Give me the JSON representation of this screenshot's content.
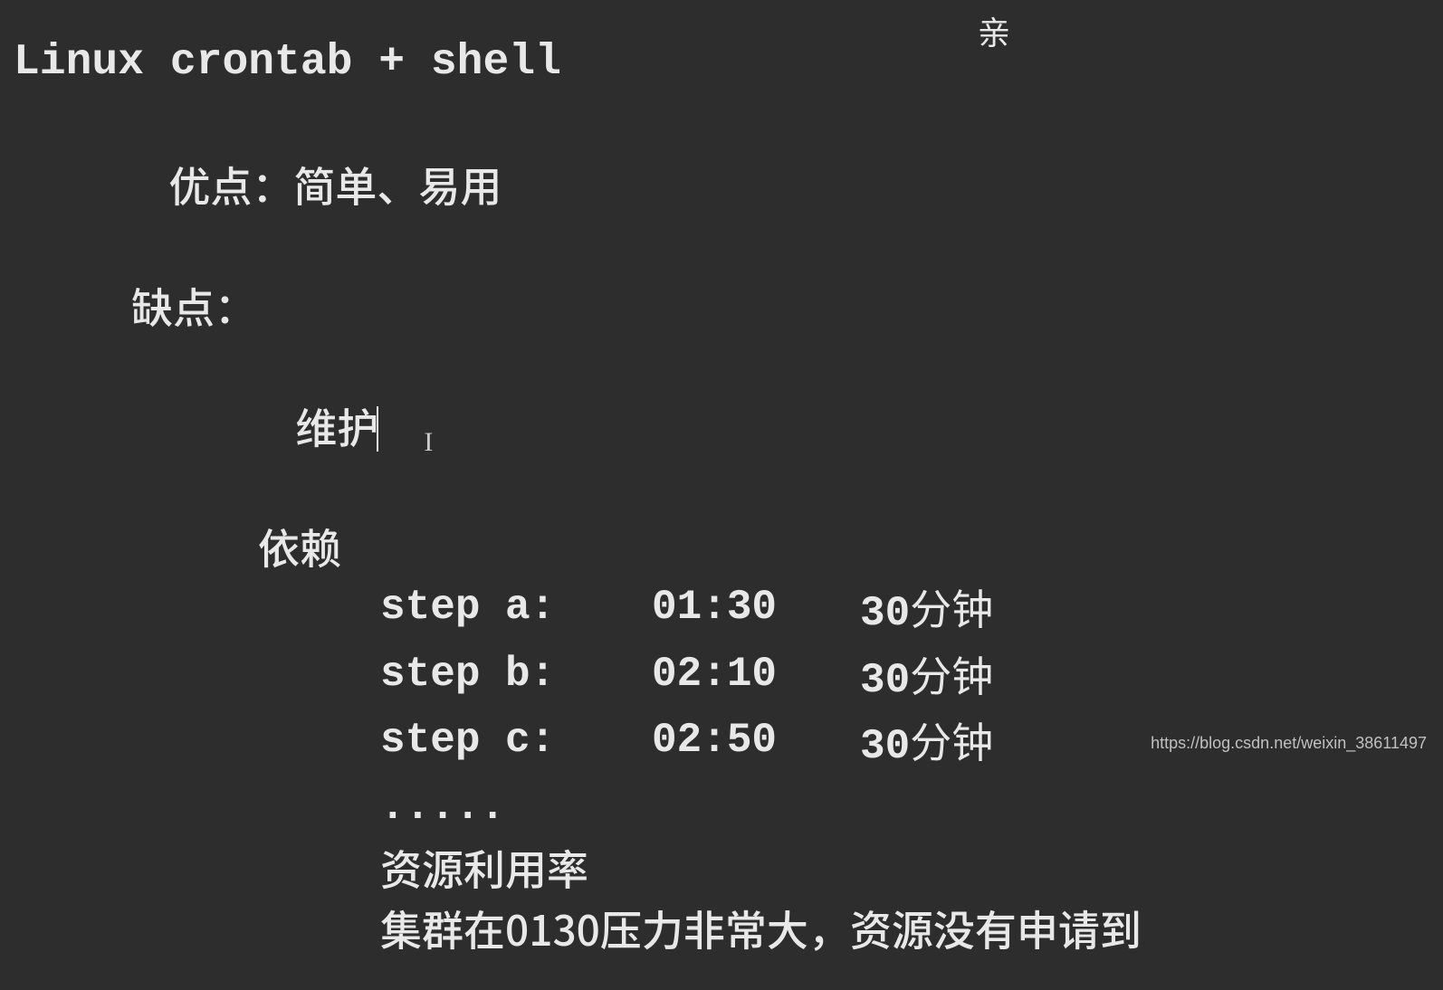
{
  "topChar": "亲",
  "title": "Linux crontab + shell",
  "pros": {
    "label": "优点：",
    "text": "简单、易用"
  },
  "cons": {
    "label": "缺点：",
    "items": {
      "maintain": "维护",
      "depend": "依赖"
    },
    "steps": [
      {
        "label": "step a:",
        "time": "01:30",
        "dur_num": "30",
        "dur_unit": "分钟"
      },
      {
        "label": "step b:",
        "time": "02:10",
        "dur_num": "30",
        "dur_unit": "分钟"
      },
      {
        "label": "step c:",
        "time": "02:50",
        "dur_num": "30",
        "dur_unit": "分钟"
      }
    ],
    "ellipsis": ".....",
    "resource": "资源利用率",
    "cluster": "集群在0130压力非常大，资源没有申请到"
  },
  "watermark": "https://blog.csdn.net/weixin_38611497"
}
